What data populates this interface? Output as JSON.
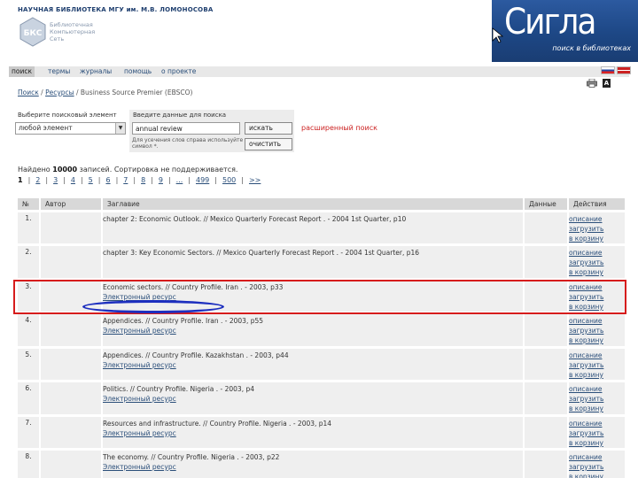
{
  "header": {
    "library_name": "НАУЧНАЯ БИБЛИОТЕКА МГУ им. М.В. ЛОМОНОСОВА",
    "logo_text": [
      "Библиотечная",
      "Компьютерная",
      "Сеть"
    ],
    "logo_abbr": "БКС",
    "brand_title": "Сигла",
    "brand_subtitle": "поиск в библиотеках"
  },
  "nav": {
    "items": [
      {
        "label": "поиск",
        "active": true
      },
      {
        "label": "термы",
        "active": false
      },
      {
        "label": "журналы",
        "active": false
      },
      {
        "label": "помощь",
        "active": false
      },
      {
        "label": "о проекте",
        "active": false
      }
    ]
  },
  "breadcrumb": {
    "items": [
      "Поиск",
      "Ресурсы"
    ],
    "current": "Business Source Premier (EBSCO)"
  },
  "search": {
    "select_label": "Выберите поисковый элемент",
    "select_value": "любой элемент",
    "input_label": "Введите данные для поиска",
    "input_value": "annual review",
    "hint": "Для усечения слов справа используйте символ *.",
    "search_button": "искать",
    "clear_button": "очистить",
    "advanced_link": "расширенный поиск"
  },
  "results_summary": {
    "prefix": "Найдено",
    "count": "10000",
    "suffix": "записей. Сортировка не поддерживается."
  },
  "pager": {
    "current": "1",
    "pages": [
      "2",
      "3",
      "4",
      "5",
      "6",
      "7",
      "8",
      "9",
      "...",
      "499",
      "500",
      ">>"
    ]
  },
  "table": {
    "headers": [
      "№",
      "Автор",
      "Заглавие",
      "Данные",
      "Действия"
    ],
    "rows": [
      {
        "num": "1.",
        "author": "",
        "title": "chapter 2: Economic Outlook. // Mexico Quarterly Forecast Report . - 2004 1st Quarter, p10",
        "link": "",
        "data": ""
      },
      {
        "num": "2.",
        "author": "",
        "title": "chapter 3: Key Economic Sectors. // Mexico Quarterly Forecast Report . - 2004 1st Quarter, p16",
        "link": "",
        "data": ""
      },
      {
        "num": "3.",
        "author": "",
        "title": "Economic sectors. // Country Profile. Iran . - 2003, p33",
        "link": "Электронный ресурс",
        "data": ""
      },
      {
        "num": "4.",
        "author": "",
        "title": "Appendices. // Country Profile. Iran . - 2003, p55",
        "link": "Электронный ресурс",
        "data": ""
      },
      {
        "num": "5.",
        "author": "",
        "title": "Appendices. // Country Profile. Kazakhstan . - 2003, p44",
        "link": "Электронный ресурс",
        "data": ""
      },
      {
        "num": "6.",
        "author": "",
        "title": "Politics. // Country Profile. Nigeria . - 2003, p4",
        "link": "Электронный ресурс",
        "data": ""
      },
      {
        "num": "7.",
        "author": "",
        "title": "Resources and infrastructure. // Country Profile. Nigeria . - 2003, p14",
        "link": "Электронный ресурс",
        "data": ""
      },
      {
        "num": "8.",
        "author": "",
        "title": "The economy. // Country Profile. Nigeria . - 2003, p22",
        "link": "Электронный ресурс",
        "data": ""
      }
    ],
    "actions": [
      "описание",
      "загрузить",
      "в корзину"
    ]
  },
  "colors": {
    "highlight_rect": "#d61c1c",
    "highlight_ellipse": "#1d2fbf",
    "link": "#2b4f7a",
    "brand_bg": "#1d4785"
  }
}
